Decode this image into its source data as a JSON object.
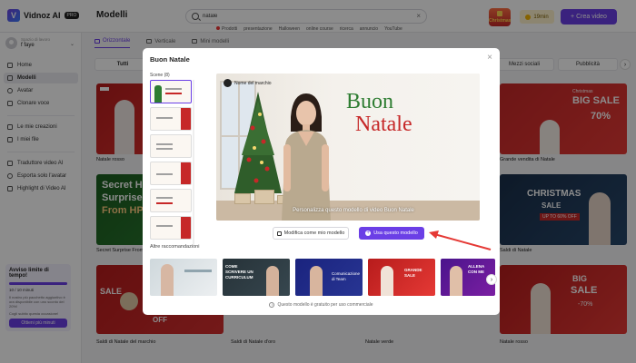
{
  "app": {
    "brand": "Vidnoz AI",
    "plan_badge": "PRO",
    "page_title": "Modelli"
  },
  "search": {
    "value": "natale",
    "clear": "×"
  },
  "tags": [
    "Prodotti",
    "presentazione",
    "Halloween",
    "online course",
    "ricerca",
    "annuncio",
    "YouTube"
  ],
  "header": {
    "promo": "Christmas",
    "credits": "19min",
    "create_label": "+ Crea video"
  },
  "user": {
    "space": "Spazio di lavoro",
    "name": "f faye"
  },
  "sidebar": {
    "items": [
      {
        "label": "Home"
      },
      {
        "label": "Modelli"
      },
      {
        "label": "Avatar"
      },
      {
        "label": "Clonare voce"
      },
      {
        "label": "Le mie creazioni"
      },
      {
        "label": "I miei file"
      },
      {
        "label": "Traduttore video AI"
      },
      {
        "label": "Esporta solo l'avatar"
      },
      {
        "label": "Highlight di Video AI"
      }
    ],
    "limit": {
      "title": "Avviso limite di tempo!",
      "count": "10 / 10 minuti",
      "progress": 1.0,
      "text": "Il nostro piú pacchetto aggiuntivo è ora disponibile con uno sconto del 20%!",
      "text2": "Cogli subito questa occasione!",
      "button": "Ottieni più minuti"
    }
  },
  "content_tabs": [
    "Orizzontale",
    "Verticale",
    "Mini modelli"
  ],
  "filters": {
    "all": "Tutti",
    "social": "Mezzi sociali",
    "ads": "Pubblicità",
    "next": "›"
  },
  "cards": [
    {
      "label": "Natale rosso"
    },
    {
      "label": "Grande vendita di Natale"
    },
    {
      "label": "Secret Surprise From HP"
    },
    {
      "label": "Saldi di Natale"
    },
    {
      "label": "Saldi di Natale del marchio"
    },
    {
      "label": "Saldi di Natale d'oro"
    },
    {
      "label": "Natale verde"
    },
    {
      "label": "Natale rosso"
    }
  ],
  "card_texts": {
    "big_sale": "BIG SALE",
    "christmas_sale": "Christmas",
    "off70": "70%",
    "off_label": "OFF",
    "secret_hint": "Secret H",
    "surprise": "Surprise",
    "from_hp": "From HP",
    "christmas": "CHRISTMAS",
    "sale": "SALE",
    "off60": "UP TO 60% OFF",
    "sale2": "SALE",
    "off": "OFF",
    "big": "BIG",
    "sale3": "SALE",
    "pct": "-70%"
  },
  "modal": {
    "title": "Buon Natale",
    "close": "×",
    "scenes_label": "Scene (8)",
    "preview": {
      "brand": "Nome del marchio",
      "buon": "Buon",
      "natale": "Natale",
      "subtitle": "Personalizza questo modello di video Buon Natale"
    },
    "edit_button": "Modifica come mio modello",
    "use_button": "Usa questo modello",
    "recommendations_label": "Altre raccomandazioni",
    "rec_texts": {
      "r2": "COME SCRIVERE UN CURRICULUM",
      "r3": "Comunicazione di Team",
      "r4": "GRANDE SALE",
      "r5": "ALLENA CON ME"
    },
    "rec_next": "›",
    "footnote": "Questo modello è gratuito per uso commerciale"
  },
  "colors": {
    "accent": "#6b3fe6",
    "christmas_red": "#c62828",
    "christmas_green": "#2e7d32"
  }
}
